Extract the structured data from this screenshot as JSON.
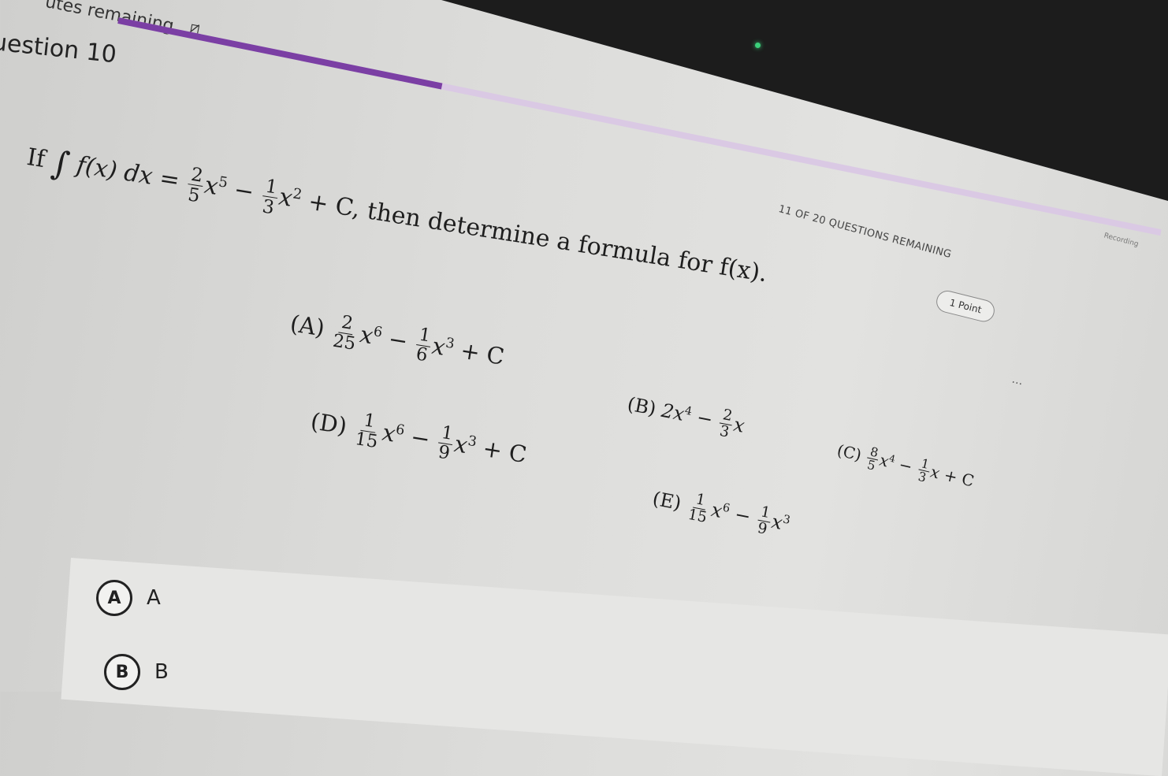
{
  "header": {
    "timer_text": "utes remaining",
    "timer_icon": "eye-slash-icon",
    "question_title": "uestion 10",
    "progress_fraction": 0.31,
    "remaining_label": "11 OF 20 QUESTIONS REMAINING",
    "points_badge": "1 Point",
    "more_icon": "…",
    "corner_text": "Recording"
  },
  "colors": {
    "progress_accent": "#7b3fa4",
    "progress_track": "#dac9e4",
    "webcam_light": "#3bd07a"
  },
  "question": {
    "if": "If",
    "integral_symbol": "∫",
    "integrand": "f(x) dx =",
    "t1_num": "2",
    "t1_den": "5",
    "t1_var": "x",
    "t1_exp": "5",
    "minus": "−",
    "t2_num": "1",
    "t2_den": "3",
    "t2_var": "x",
    "t2_exp": "2",
    "tail": "+ C, then determine a formula for f(x)."
  },
  "choices": {
    "a": {
      "label": "(A)",
      "n1": "2",
      "d1": "25",
      "v1": "x",
      "e1": "6",
      "op": "−",
      "n2": "1",
      "d2": "6",
      "v2": "x",
      "e2": "3",
      "tail": "+ C"
    },
    "b": {
      "label": "(B)",
      "lead": "2x",
      "e1": "4",
      "op": "−",
      "n2": "2",
      "d2": "3",
      "v2": "x"
    },
    "c": {
      "label": "(C)",
      "n1": "8",
      "d1": "5",
      "v1": "x",
      "e1": "4",
      "op": "−",
      "n2": "1",
      "d2": "3",
      "v2": "x",
      "tail": "+ C"
    },
    "d": {
      "label": "(D)",
      "n1": "1",
      "d1": "15",
      "v1": "x",
      "e1": "6",
      "op": "−",
      "n2": "1",
      "d2": "9",
      "v2": "x",
      "e2": "3",
      "tail": "+ C"
    },
    "e": {
      "label": "(E)",
      "n1": "1",
      "d1": "15",
      "v1": "x",
      "e1": "6",
      "op": "−",
      "n2": "1",
      "d2": "9",
      "v2": "x",
      "e2": "3"
    }
  },
  "answers": [
    {
      "letter": "A",
      "text": "A"
    },
    {
      "letter": "B",
      "text": "B"
    }
  ]
}
